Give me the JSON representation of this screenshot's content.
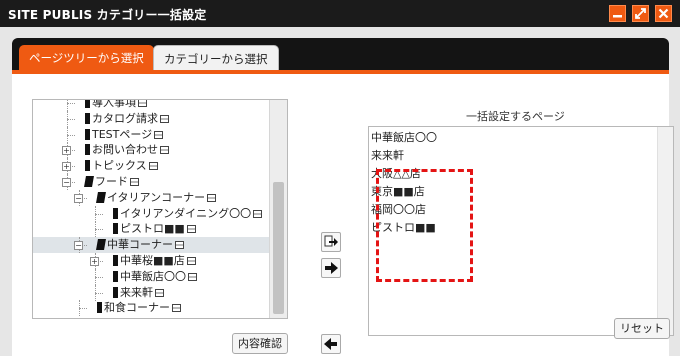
{
  "window": {
    "title": "SITE PUBLIS カテゴリー一括設定"
  },
  "tabs": [
    {
      "label": "ページツリーから選択",
      "active": true
    },
    {
      "label": "カテゴリーから選択",
      "active": false
    }
  ],
  "tree": {
    "nodes": [
      {
        "label": "導入事項",
        "icon": "page-black-icon",
        "expander": null
      },
      {
        "label": "カタログ請求",
        "icon": "page-black-icon",
        "expander": null
      },
      {
        "label": "TESTページ",
        "icon": "page-black-icon",
        "expander": null
      },
      {
        "label": "お問い合わせ",
        "icon": "page-black-icon",
        "expander": "+"
      },
      {
        "label": "トピックス",
        "icon": "page-black-icon",
        "expander": "+"
      },
      {
        "label": "フード",
        "icon": "folder-black-icon",
        "expander": "-"
      },
      {
        "label": "イタリアンコーナー",
        "icon": "folder-black-icon",
        "expander": "-"
      },
      {
        "label": "イタリアンダイニング〇〇",
        "icon": "page-black-icon",
        "expander": null
      },
      {
        "label": "ピストロ■■",
        "icon": "page-black-icon",
        "expander": null
      },
      {
        "label": "中華コーナー",
        "icon": "folder-black-icon",
        "expander": "-",
        "selected": true
      },
      {
        "label": "中華桜■■店",
        "icon": "page-black-icon",
        "expander": "+"
      },
      {
        "label": "中華飯店〇〇",
        "icon": "page-black-icon",
        "expander": null
      },
      {
        "label": "来来軒",
        "icon": "page-black-icon",
        "expander": null
      },
      {
        "label": "和食コーナー",
        "icon": "page-black-icon",
        "expander": null
      }
    ]
  },
  "right": {
    "label": "一括設定するページ",
    "items": [
      "中華飯店〇〇",
      "来来軒",
      "大阪△△店",
      "東京■■店",
      "福岡〇〇店",
      "ピストロ■■"
    ]
  },
  "buttons": {
    "add_all": "add-all-icon",
    "add": "add-right-arrow-icon",
    "remove": "remove-left-arrow-icon",
    "confirm": "内容確認",
    "reset": "リセット"
  },
  "colors": {
    "accent": "#ef5a12",
    "titlebar": "#1b1b1b",
    "highlight": "#e41414"
  }
}
